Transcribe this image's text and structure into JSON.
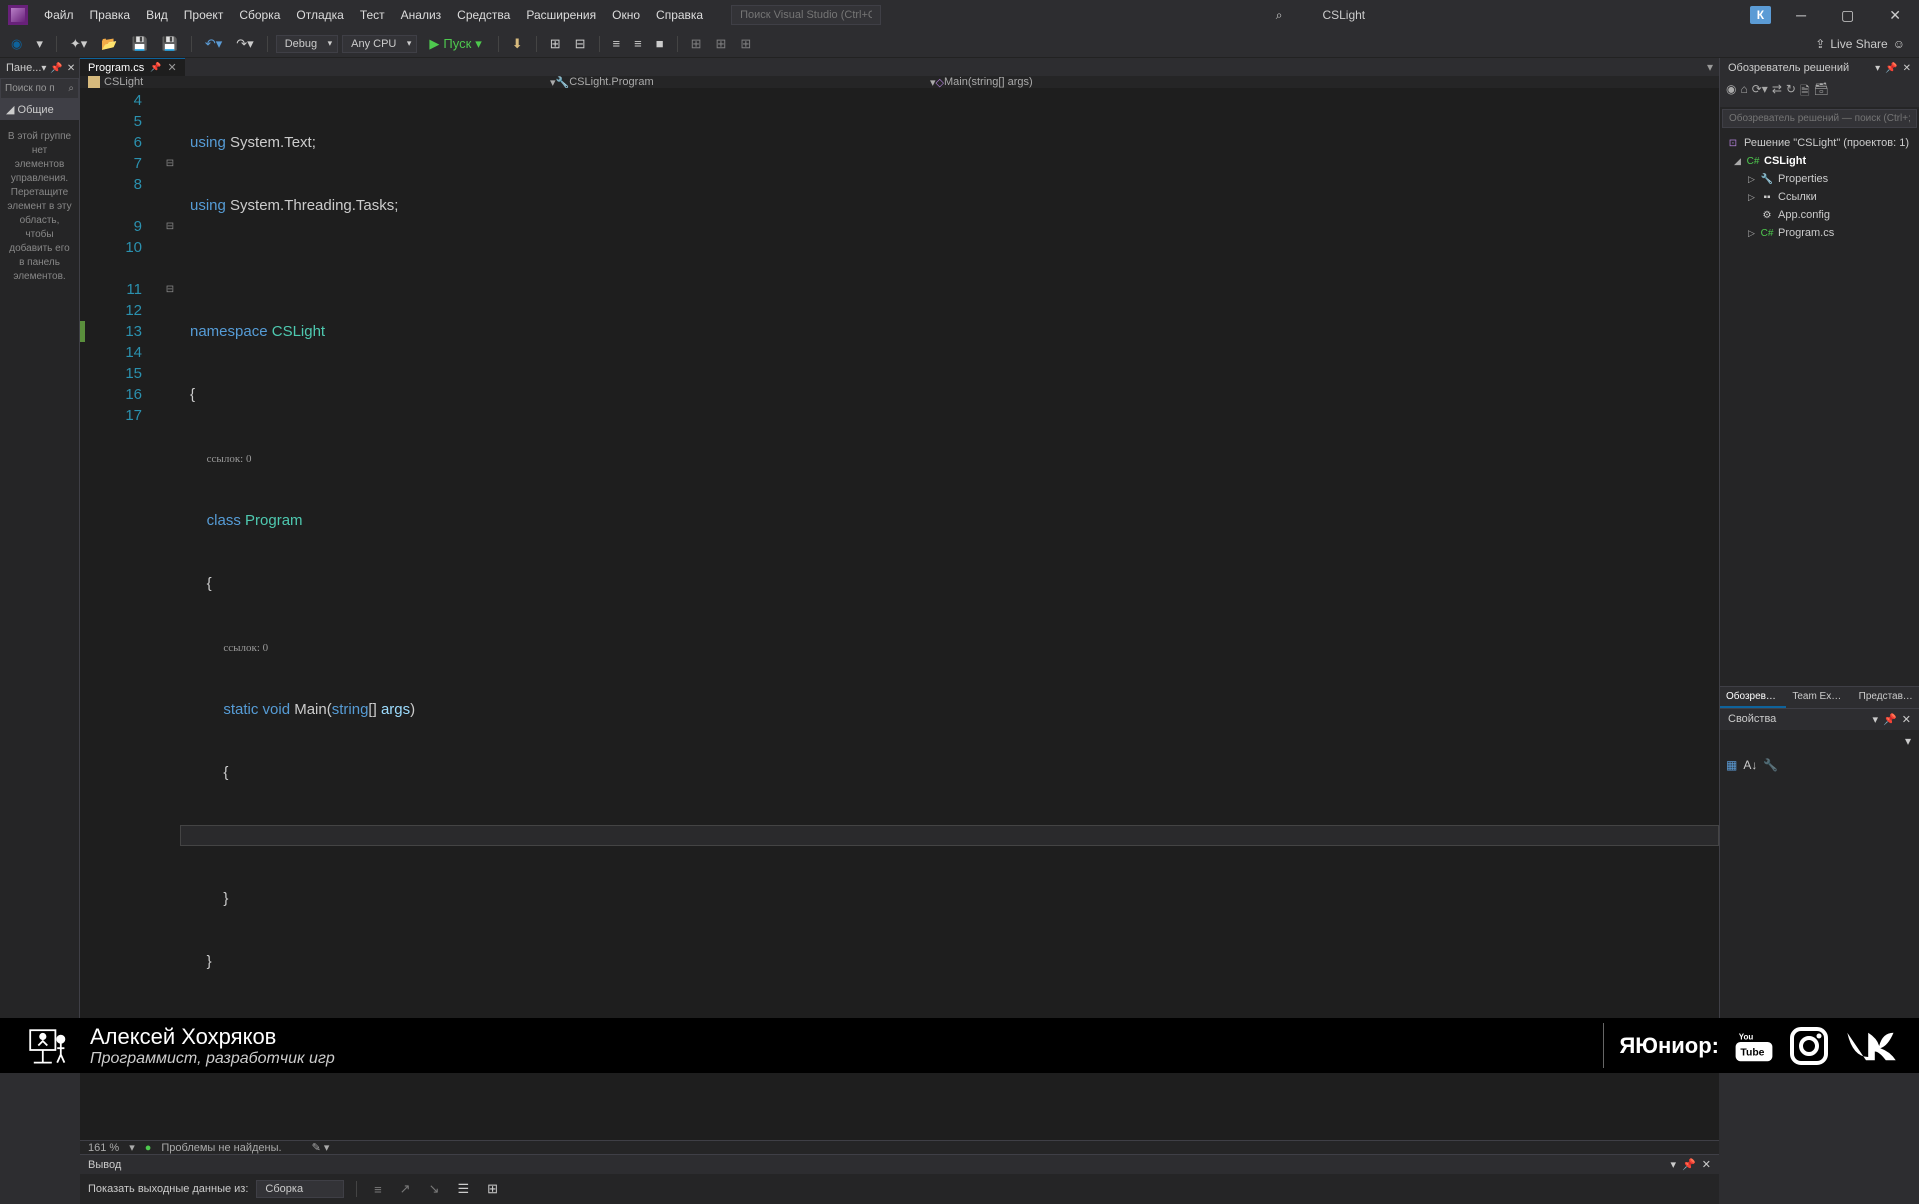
{
  "titlebar": {
    "menus": [
      "Файл",
      "Правка",
      "Вид",
      "Проект",
      "Сборка",
      "Отладка",
      "Тест",
      "Анализ",
      "Средства",
      "Расширения",
      "Окно",
      "Справка"
    ],
    "search_placeholder": "Поиск Visual Studio (Ctrl+Q)",
    "project": "CSLight",
    "user_initial": "К"
  },
  "toolbar": {
    "config": "Debug",
    "platform": "Any CPU",
    "run": "Пуск",
    "live_share": "Live Share"
  },
  "toolbox": {
    "title": "Пане...",
    "search": "Поиск по п",
    "section": "Общие",
    "text": "В этой группе нет элементов управления. Перетащите элемент в эту область, чтобы добавить его в панель элементов."
  },
  "editor": {
    "tab": "Program.cs",
    "bc_file": "CSLight",
    "bc_class": "CSLight.Program",
    "bc_method": "Main(string[] args)",
    "zoom": "161 %",
    "status": "Проблемы не найдены.",
    "lines": {
      "l4a": "using",
      "l4b": " System.Text;",
      "l5a": "using",
      "l5b": " System.Threading.Tasks;",
      "l7a": "namespace",
      "l7b": " CSLight",
      "l8": "{",
      "ref1": "ссылок: 0",
      "l9a": "    class",
      "l9b": " Program",
      "l10": "    {",
      "ref2": "ссылок: 0",
      "l11a": "        static",
      "l11b": " void",
      "l11c": " Main(",
      "l11d": "string",
      "l11e": "[] ",
      "l11f": "args",
      "l11g": ")",
      "l12": "        {",
      "l13": "            ",
      "l14": "        }",
      "l15": "    }",
      "l16": "}"
    }
  },
  "output": {
    "title": "Вывод",
    "label": "Показать выходные данные из:",
    "source": "Сборка"
  },
  "solution_explorer": {
    "title": "Обозреватель решений",
    "search_placeholder": "Обозреватель решений — поиск (Ctrl+;)",
    "solution": "Решение \"CSLight\" (проектов: 1)",
    "project": "CSLight",
    "items": [
      "Properties",
      "Ссылки",
      "App.config",
      "Program.cs"
    ],
    "tabs": [
      "Обозревате...",
      "Team Explor...",
      "Представле..."
    ]
  },
  "properties": {
    "title": "Свойства"
  },
  "overlay": {
    "name": "Алексей Хохряков",
    "title": "Программист, разработчик игр",
    "brand": "ЯЮниор:"
  }
}
